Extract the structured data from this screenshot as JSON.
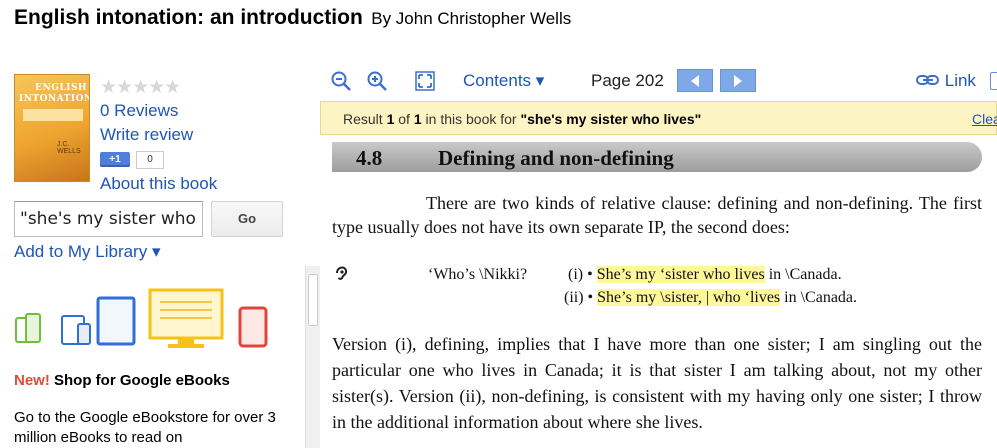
{
  "header": {
    "title": "English intonation: an introduction",
    "author": "By John Christopher Wells"
  },
  "sidebar": {
    "cover_title": "ENGLISH INTONATION",
    "cover_author": "J.C. WELLS",
    "rating_stars": "★★★★★",
    "reviews_label": "0 Reviews",
    "write_review_label": "Write review",
    "plusone_label": "+1",
    "plusone_count": "0",
    "about_label": "About this book",
    "search": {
      "value": "\"she's my sister who",
      "button_label": "Go"
    },
    "library_label": "Add to My Library ▾",
    "shop": {
      "new_label": "New!",
      "shop_label": "Shop for Google eBooks"
    },
    "promo_text": "Go to the Google eBookstore for over 3 million eBooks to read on"
  },
  "toolbar": {
    "contents_label": "Contents ▾",
    "page_label": "Page 202",
    "link_label": "Link",
    "icons": [
      "zoom-out-icon",
      "zoom-in-icon",
      "fullscreen-icon",
      "prev-page-icon",
      "next-page-icon",
      "link-icon"
    ]
  },
  "result": {
    "prefix": "Result ",
    "current": "1",
    "of": " of ",
    "total": "1",
    "middle": " in this book for ",
    "query": "\"she's my sister who lives\"",
    "clear_label": "Clea"
  },
  "page": {
    "section_number": "4.8",
    "section_title": "Defining and non-defining",
    "para1": "There are two kinds of relative clause: defining and non-defining. The first type usually does not have its own separate IP, the second does:",
    "example_prompt": "‘Who’s \\Nikki?",
    "ex1_label": "(i) •",
    "ex1_highlight": "She’s my ‘sister who lives",
    "ex1_rest_a": " in ",
    "ex1_rest_b": "\\Canada.",
    "ex2_label": "(ii) •",
    "ex2_highlight": "She’s my \\sister, | who ‘lives",
    "ex2_rest_a": " in ",
    "ex2_rest_b": "\\Canada.",
    "para2": "Version (i), defining, implies that I have more than one sister; I am singling out the particular one who lives in Canada; it is that sister I am talking about, not my other sister(s). Version (ii), non-defining, is consistent with my having only one sister; I throw in the additional information about where she lives."
  },
  "colors": {
    "link": "#1f55b5",
    "result_bar": "#fdf4c4",
    "highlight": "#fff89a",
    "nav_button": "#7ea8e8",
    "new_red": "#dd4b39"
  }
}
